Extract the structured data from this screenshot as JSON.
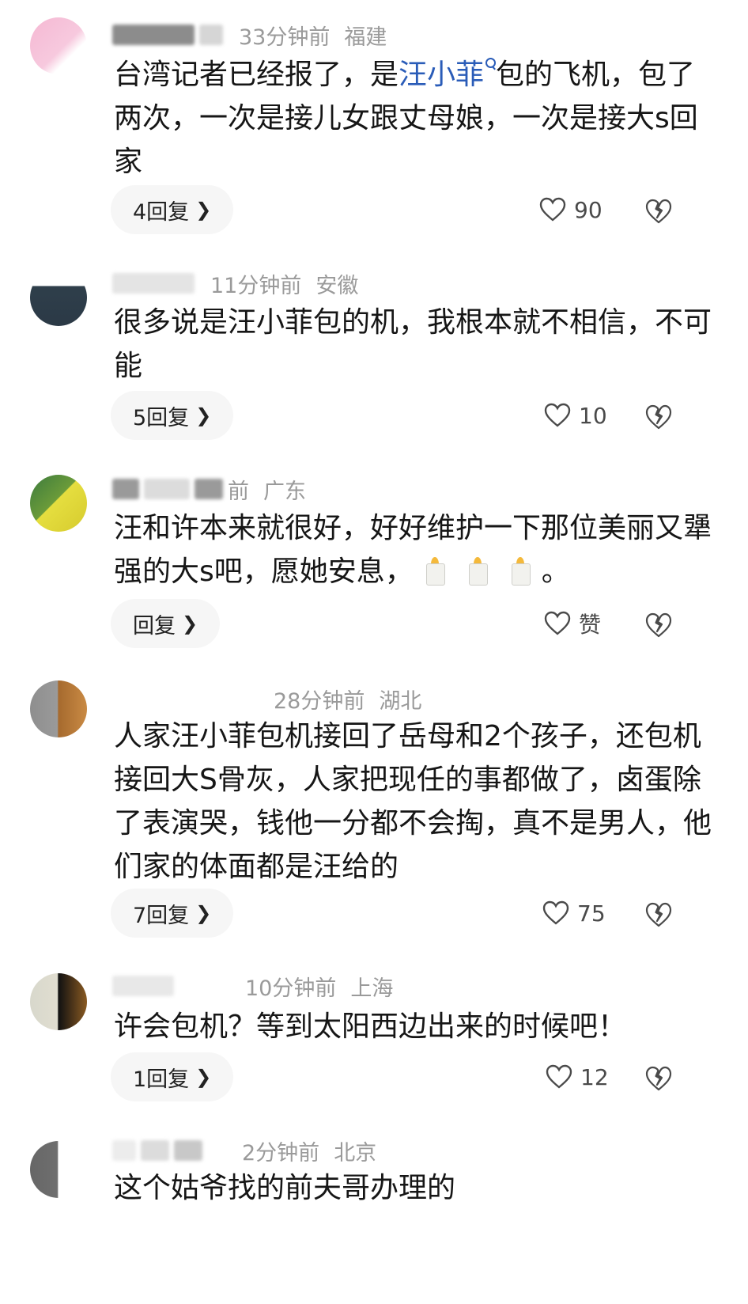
{
  "colors": {
    "text": "#161616",
    "meta": "#9a9a9a",
    "link": "#2a5cb8",
    "reply_bg": "#f6f6f6"
  },
  "comments": [
    {
      "time": "33分钟前",
      "region": "福建",
      "text_before": "台湾记者已经报了，是",
      "link": "汪小菲",
      "text_after": "包的飞机，包了两次，一次是接儿女跟丈母娘，一次是接大s回家",
      "reply_label": "4回复",
      "like_count": "90"
    },
    {
      "time": "11分钟前",
      "region": "安徽",
      "text": "很多说是汪小菲包的机，我根本就不相信，不可能",
      "reply_label": "5回复",
      "like_count": "10"
    },
    {
      "time": "前",
      "region": "广东",
      "text_before": "汪和许本来就很好，好好维护一下那位美丽又犟强的大s吧，愿她安息，",
      "emoji": "candle-icon",
      "text_after": "。",
      "reply_label": "回复",
      "like_count": "赞"
    },
    {
      "time": "28分钟前",
      "region": "湖北",
      "text": "人家汪小菲包机接回了岳母和2个孩子，还包机接回大S骨灰，人家把现任的事都做了，卤蛋除了表演哭，钱他一分都不会掏，真不是男人，他们家的体面都是汪给的",
      "reply_label": "7回复",
      "like_count": "75"
    },
    {
      "time": "10分钟前",
      "region": "上海",
      "text": "许会包机？等到太阳西边出来的时候吧！",
      "reply_label": "1回复",
      "like_count": "12"
    },
    {
      "time": "2分钟前",
      "region": "北京",
      "text": "这个姑爷找的前夫哥办理的"
    }
  ]
}
